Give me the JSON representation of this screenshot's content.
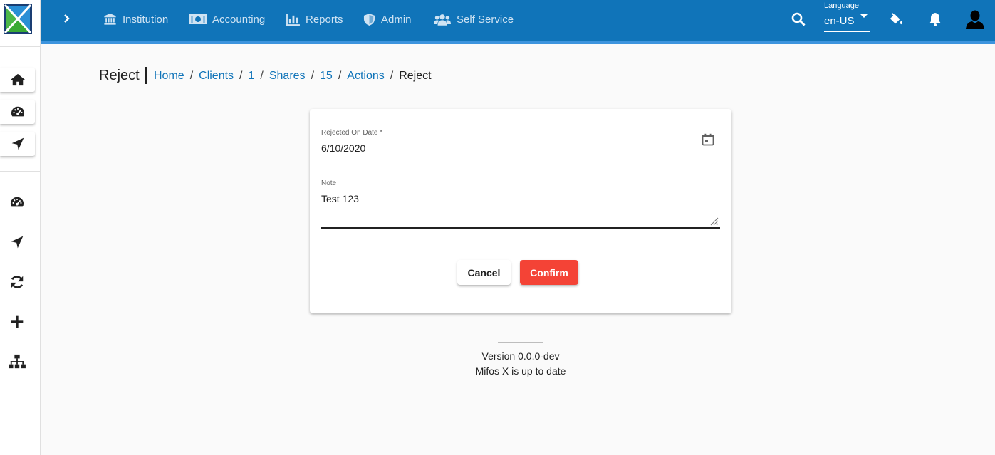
{
  "topbar": {
    "nav": [
      {
        "label": "Institution",
        "icon": "institution-icon"
      },
      {
        "label": "Accounting",
        "icon": "money-icon"
      },
      {
        "label": "Reports",
        "icon": "chart-icon"
      },
      {
        "label": "Admin",
        "icon": "shield-icon"
      },
      {
        "label": "Self Service",
        "icon": "users-icon"
      }
    ],
    "language_label": "Language",
    "language_value": "en-US",
    "colors": {
      "bar": "#1074b9",
      "strip": "#3d94de",
      "nav_text": "#cfe3f3"
    }
  },
  "sidebar": {
    "buttons": [
      "home-icon",
      "dashboard-icon",
      "navigation-icon"
    ],
    "icons": [
      "dashboard-icon",
      "navigation-icon",
      "sync-icon",
      "plus-icon",
      "sitemap-icon"
    ]
  },
  "page": {
    "title": "Reject",
    "breadcrumbs": [
      "Home",
      "Clients",
      "1",
      "Shares",
      "15",
      "Actions"
    ],
    "breadcrumb_separator": "/",
    "current": "Reject"
  },
  "form": {
    "date_label": "Rejected On Date *",
    "date_value": "6/10/2020",
    "note_label": "Note",
    "note_value": "Test 123",
    "cancel_label": "Cancel",
    "confirm_label": "Confirm",
    "confirm_color": "#f44336"
  },
  "footer": {
    "version": "Version 0.0.0-dev",
    "status": "Mifos X is up to date"
  }
}
